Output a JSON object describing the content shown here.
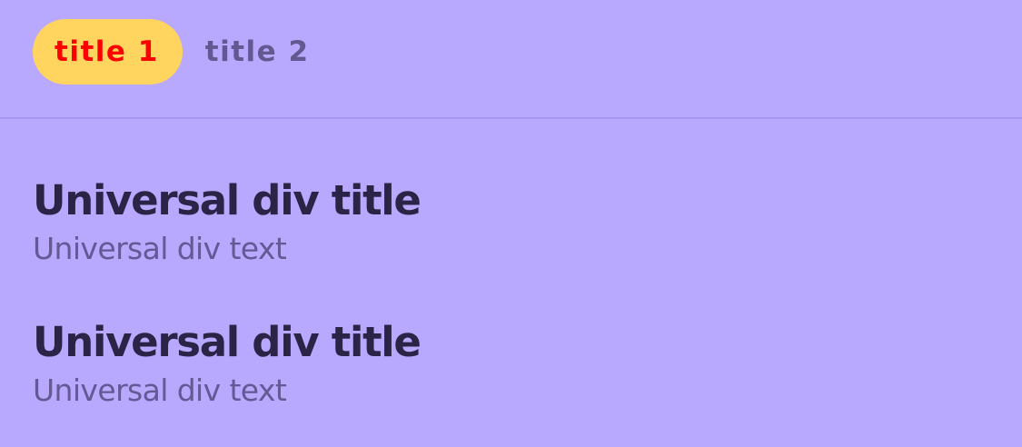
{
  "tabs": [
    {
      "label": "title 1",
      "active": true
    },
    {
      "label": "title 2",
      "active": false
    }
  ],
  "items": [
    {
      "title": "Universal div title",
      "text": "Universal div text"
    },
    {
      "title": "Universal div title",
      "text": "Universal div text"
    }
  ],
  "colors": {
    "background": "#b8a8fe",
    "active_tab_bg": "#ffd45f",
    "active_tab_text": "#ff0000",
    "inactive_tab_text": "#63588f",
    "title_text": "#2b2446",
    "body_text": "#635994"
  }
}
